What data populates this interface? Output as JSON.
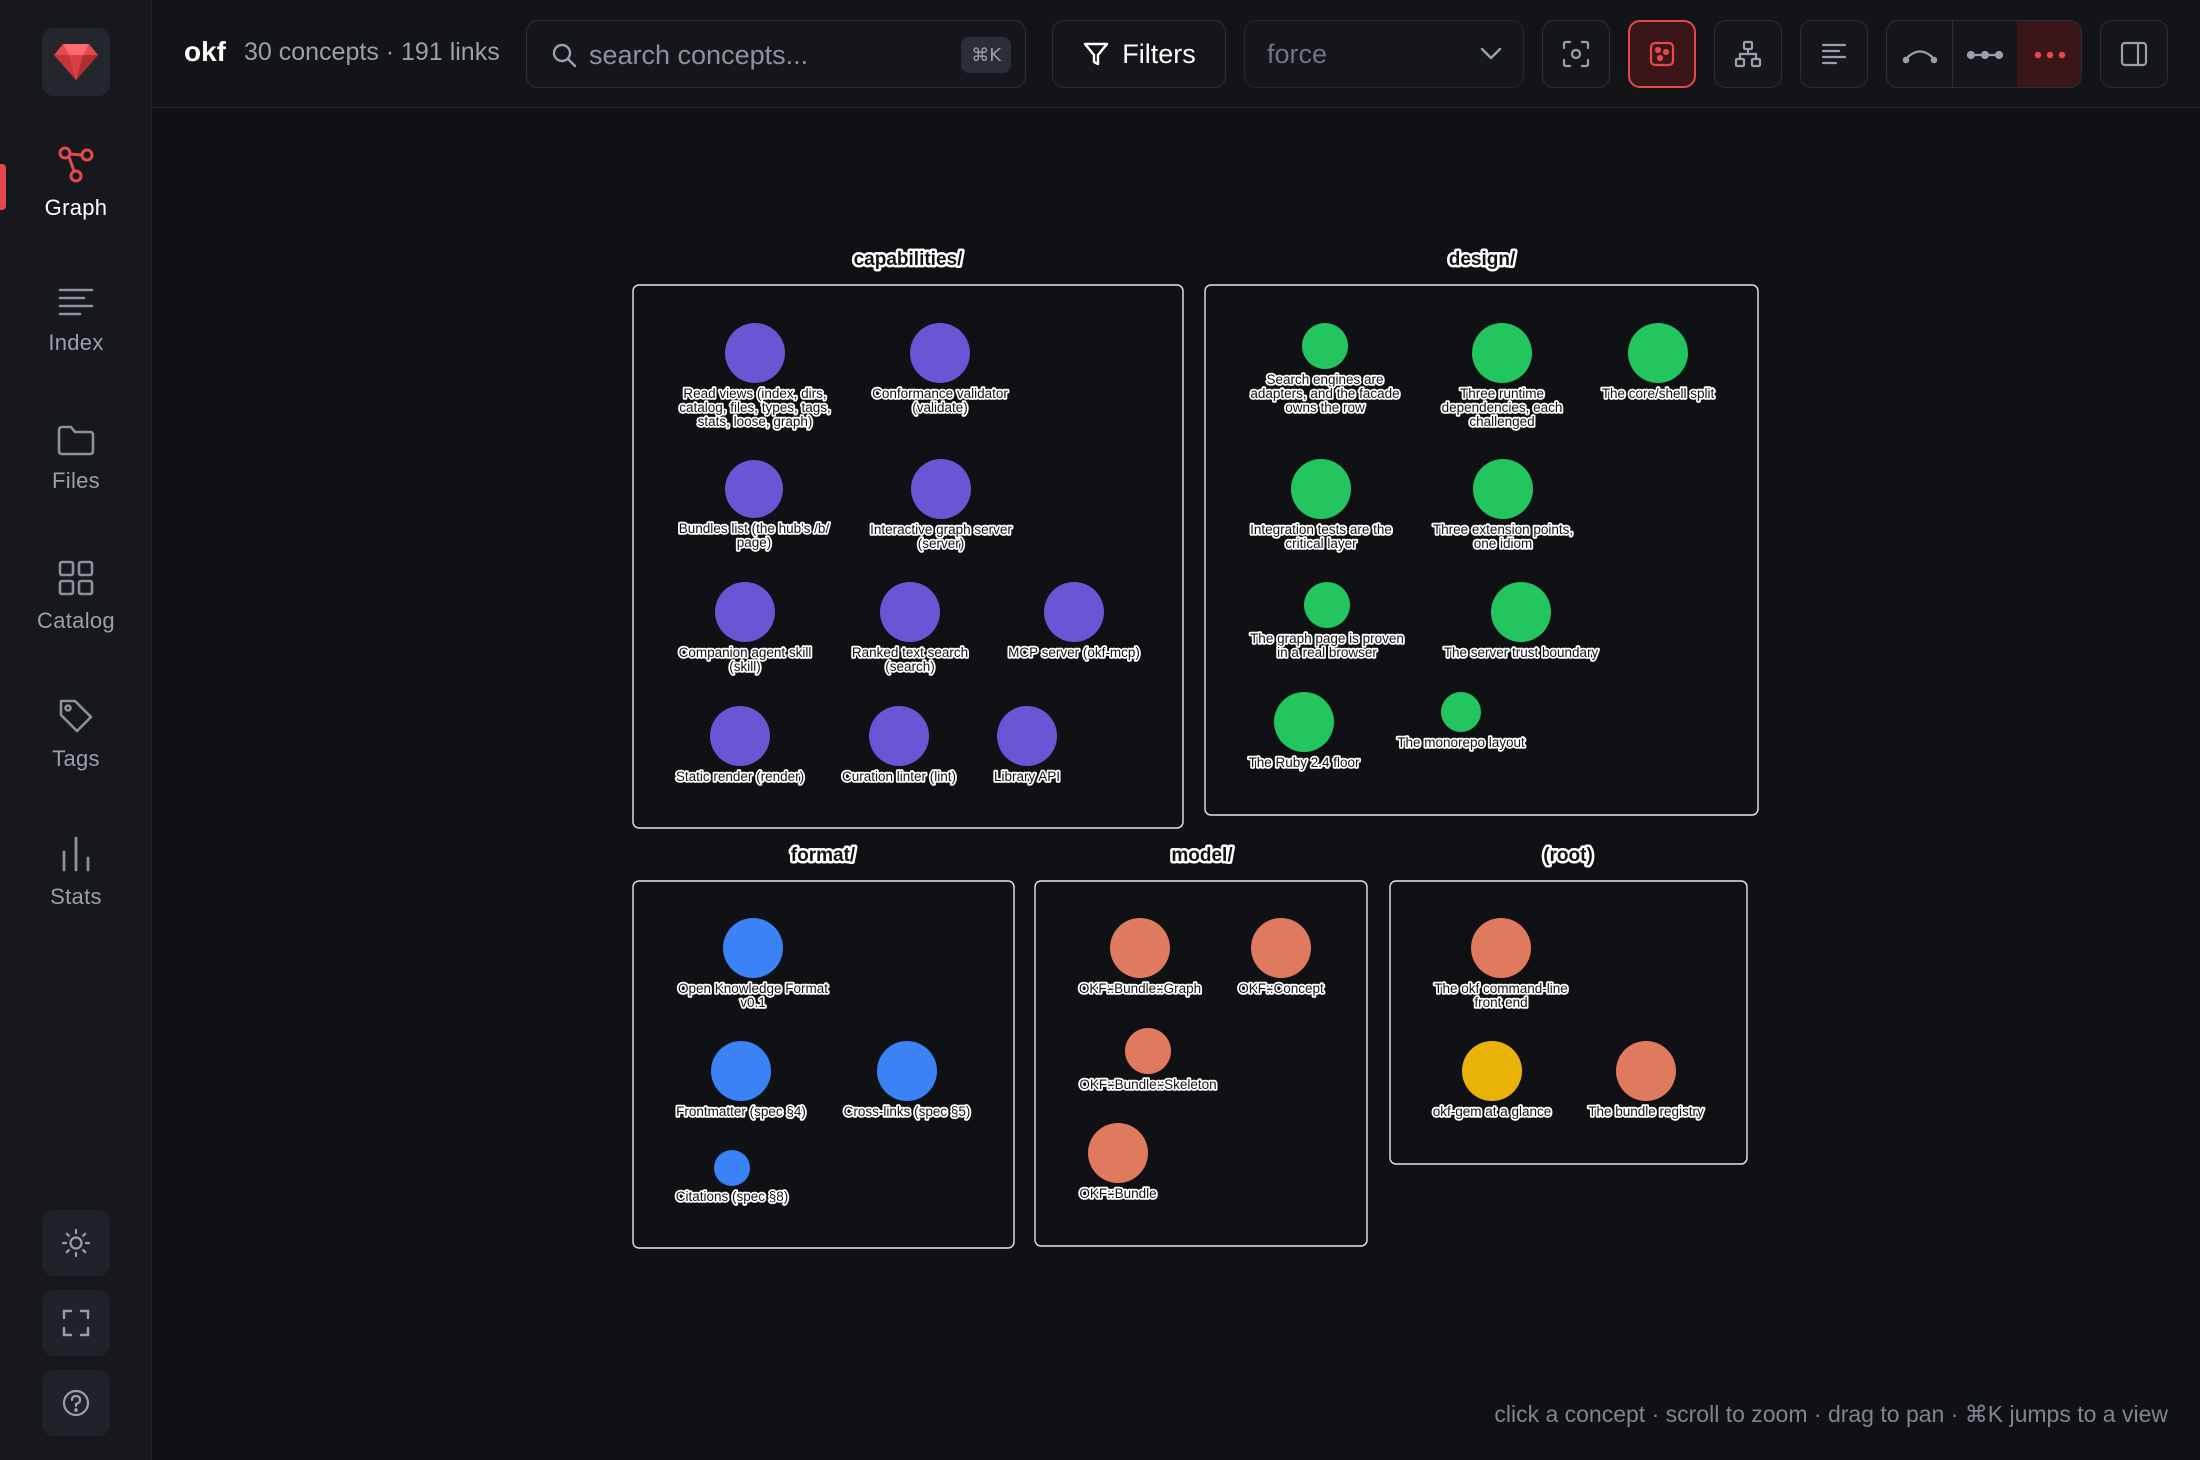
{
  "app": {
    "name": "okf",
    "meta": "30 concepts · 191 links"
  },
  "search": {
    "placeholder": "search concepts...",
    "shortcut": "⌘K"
  },
  "toolbar": {
    "filters_label": "Filters",
    "layout_value": "force",
    "buttons": [
      "fit-view-icon",
      "cluster-icon",
      "hierarchy-icon",
      "list-icon",
      "curved-edges-icon",
      "straight-edges-icon",
      "dotted-edges-icon",
      "side-panel-icon"
    ]
  },
  "sidebar": {
    "items": [
      {
        "label": "Graph",
        "icon": "graph-icon",
        "active": true
      },
      {
        "label": "Index",
        "icon": "index-icon",
        "active": false
      },
      {
        "label": "Files",
        "icon": "folder-icon",
        "active": false
      },
      {
        "label": "Catalog",
        "icon": "grid-icon",
        "active": false
      },
      {
        "label": "Tags",
        "icon": "tag-icon",
        "active": false
      },
      {
        "label": "Stats",
        "icon": "bar-chart-icon",
        "active": false
      }
    ],
    "bottom": [
      "sun-icon",
      "fullscreen-icon",
      "help-icon"
    ]
  },
  "colors": {
    "accent": "#e5484d",
    "capabilities": "#6c55d4",
    "design": "#22c55e",
    "format": "#3b82f6",
    "model": "#e07a5f",
    "root_highlight": "#eab308"
  },
  "graph": {
    "groups": [
      {
        "title": "capabilities/",
        "color": "#6c55d4",
        "nodes": [
          {
            "label": [
              "Read views (index, dirs,",
              "catalog, files, types, tags,",
              "stats, loose, graph)"
            ]
          },
          {
            "label": [
              "Conformance validator",
              "(validate)"
            ]
          },
          {
            "label": [
              "Bundles list (the hub's /b/",
              "page)"
            ]
          },
          {
            "label": [
              "Interactive graph server",
              "(server)"
            ]
          },
          {
            "label": [
              "Companion agent skill",
              "(skill)"
            ]
          },
          {
            "label": [
              "Ranked text search",
              "(search)"
            ]
          },
          {
            "label": [
              "MCP server (okf-mcp)"
            ]
          },
          {
            "label": [
              "Static render (render)"
            ]
          },
          {
            "label": [
              "Curation linter (lint)"
            ]
          },
          {
            "label": [
              "Library API"
            ]
          }
        ]
      },
      {
        "title": "design/",
        "color": "#22c55e",
        "nodes": [
          {
            "label": [
              "Search engines are",
              "adapters, and the facade",
              "owns the row"
            ]
          },
          {
            "label": [
              "Three runtime",
              "dependencies, each",
              "challenged"
            ]
          },
          {
            "label": [
              "The core/shell split"
            ]
          },
          {
            "label": [
              "Integration tests are the",
              "critical layer"
            ]
          },
          {
            "label": [
              "Three extension points,",
              "one idiom"
            ]
          },
          {
            "label": [
              "The graph page is proven",
              "in a real browser"
            ]
          },
          {
            "label": [
              "The server trust boundary"
            ]
          },
          {
            "label": [
              "The Ruby 2.4 floor"
            ]
          },
          {
            "label": [
              "The monorepo layout"
            ]
          }
        ]
      },
      {
        "title": "format/",
        "color": "#3b82f6",
        "nodes": [
          {
            "label": [
              "Open Knowledge Format",
              "v0.1"
            ]
          },
          {
            "label": [
              "Frontmatter (spec §4)"
            ]
          },
          {
            "label": [
              "Cross-links (spec §5)"
            ]
          },
          {
            "label": [
              "Citations (spec §8)"
            ]
          }
        ]
      },
      {
        "title": "model/",
        "color": "#e07a5f",
        "nodes": [
          {
            "label": [
              "OKF::Bundle::Graph"
            ]
          },
          {
            "label": [
              "OKF::Concept"
            ]
          },
          {
            "label": [
              "OKF::Bundle::Skeleton"
            ]
          },
          {
            "label": [
              "OKF::Bundle"
            ]
          }
        ]
      },
      {
        "title": "(root)",
        "color": "#e07a5f",
        "nodes": [
          {
            "label": [
              "The okf command-line",
              "front end"
            ]
          },
          {
            "label": [
              "okf-gem at a glance"
            ],
            "color": "#eab308"
          },
          {
            "label": [
              "The bundle registry"
            ]
          }
        ]
      }
    ]
  },
  "hint": "click a concept · scroll to zoom · drag to pan · ⌘K jumps to a view"
}
